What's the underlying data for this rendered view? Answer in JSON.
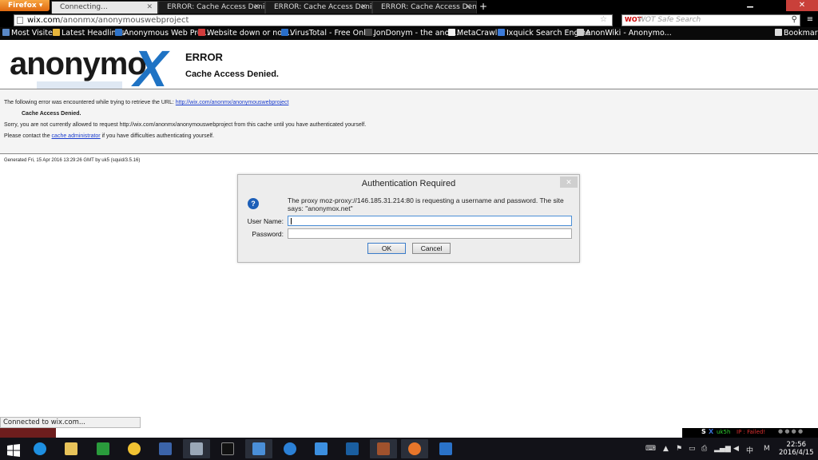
{
  "browser": {
    "app_button": "Firefox",
    "tabs": [
      {
        "label": "Connecting...",
        "active": true
      },
      {
        "label": "ERROR: Cache Access Deni...",
        "active": false
      },
      {
        "label": "ERROR: Cache Access Deni...",
        "active": false
      },
      {
        "label": "ERROR: Cache Access Deni...",
        "active": false
      }
    ],
    "new_tab": "+",
    "url_domain": "wix.com",
    "url_path": "/anonmx/anonymouswebproject",
    "search_placeholder": "WOT Safe Search",
    "search_engine_badge": "WOT"
  },
  "bookmarks": {
    "items": [
      {
        "label": "Most Visited",
        "color": "#5a88c6"
      },
      {
        "label": "Latest Headlines",
        "color": "#e8b63c"
      },
      {
        "label": "Anonymous Web Pro...",
        "color": "#2f73c8"
      },
      {
        "label": "Website down or not...",
        "color": "#d23c3c"
      },
      {
        "label": "VirusTotal - Free Onli...",
        "color": "#2a6fc9"
      },
      {
        "label": "JonDonym - the anon...",
        "color": "#444444"
      },
      {
        "label": "MetaCrawler",
        "color": "#f2f2f2"
      },
      {
        "label": "Ixquick Search Engine",
        "color": "#3c7bd8"
      },
      {
        "label": "AnonWiki - Anonymo...",
        "color": "#cccccc"
      }
    ],
    "bookmarks_menu": "Bookmarks"
  },
  "page": {
    "logo_text": "anonymo",
    "logo_x": "X",
    "title": "ERROR",
    "subtitle": "Cache Access Denied.",
    "line1_prefix": "The following error was encountered while trying to retrieve the URL: ",
    "line1_link": "http://wix.com/anonmx/anonymouswebproject",
    "line2": "Cache Access Denied.",
    "line3": "Sorry, you are not currently allowed to request http://wix.com/anonmx/anonymouswebproject from this cache until you have authenticated yourself.",
    "line4_prefix": "Please contact the ",
    "line4_link": "cache administrator",
    "line4_suffix": " if you have difficulties authenticating yourself.",
    "generated": "Generated Fri, 15 Apr 2016 13:29:26 GMT by uk5 (squid/3.5.16)"
  },
  "dialog": {
    "title": "Authentication Required",
    "message": "The proxy moz-proxy://146.185.31.214:80 is requesting a username and password. The site says: \"anonymox.net\"",
    "username_label": "User Name:",
    "password_label": "Password:",
    "username_value": "",
    "password_value": "",
    "ok_label": "OK",
    "cancel_label": "Cancel"
  },
  "status_bar": {
    "text": "Connected to wix.com..."
  },
  "system_stripe": {
    "s": "S",
    "x": "X",
    "uk": "uk5h",
    "ip": "IP : Failed!"
  },
  "taskbar": {
    "apps": [
      {
        "name": "ie-icon",
        "color": "#1e8fe0"
      },
      {
        "name": "file-explorer-icon",
        "color": "#e8c35a"
      },
      {
        "name": "store-icon",
        "color": "#2a9b3c"
      },
      {
        "name": "wechat-icon",
        "color": "#f1c232"
      },
      {
        "name": "virtualbox-icon",
        "color": "#3b63a8"
      },
      {
        "name": "network-icon",
        "color": "#9aa8b8"
      },
      {
        "name": "terminal-icon",
        "color": "#111111"
      },
      {
        "name": "remote-desktop-icon",
        "color": "#4a8fd8"
      },
      {
        "name": "cloud-icon",
        "color": "#2b80d6"
      },
      {
        "name": "teamviewer-icon",
        "color": "#3c8fe0"
      },
      {
        "name": "app-blue-icon",
        "color": "#1a5ea0"
      },
      {
        "name": "game-icon",
        "color": "#a0522d"
      },
      {
        "name": "firefox-icon",
        "color": "#e8762a"
      },
      {
        "name": "wifi-tool-icon",
        "color": "#2a72c8"
      }
    ],
    "time": "22:56",
    "date": "2016/4/15",
    "ime": "M"
  }
}
